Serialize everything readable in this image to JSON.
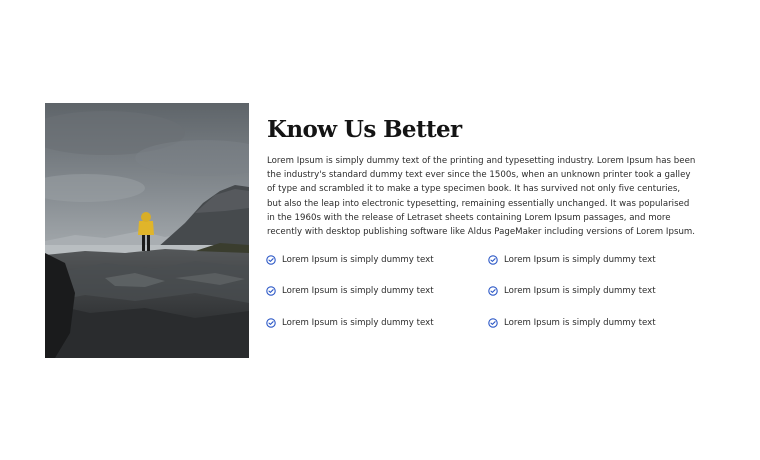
{
  "section": {
    "title": "Know Us Better",
    "description": "Lorem Ipsum is simply dummy text of the printing and typesetting industry. Lorem Ipsum has been the industry's standard dummy text ever since the 1500s, when an unknown printer took a galley of type and scrambled it to make a type specimen book. It has survived not only five centuries, but also the leap into electronic typesetting, remaining essentially unchanged. It was popularised in the 1960s with the release of Letraset sheets containing Lorem Ipsum passages, and more recently with desktop publishing software like Aldus PageMaker including versions of Lorem Ipsum."
  },
  "features": {
    "items": [
      {
        "label": "Lorem Ipsum is simply dummy text"
      },
      {
        "label": "Lorem Ipsum is simply dummy text"
      },
      {
        "label": "Lorem Ipsum is simply dummy text"
      },
      {
        "label": "Lorem Ipsum is simply dummy text"
      },
      {
        "label": "Lorem Ipsum is simply dummy text"
      },
      {
        "label": "Lorem Ipsum is simply dummy text"
      }
    ],
    "icon": "check-circle-icon",
    "icon_color": "#2b57c6"
  },
  "colors": {
    "title": "#141414",
    "text": "#2b2b2b",
    "jacket": "#e0b52a"
  }
}
